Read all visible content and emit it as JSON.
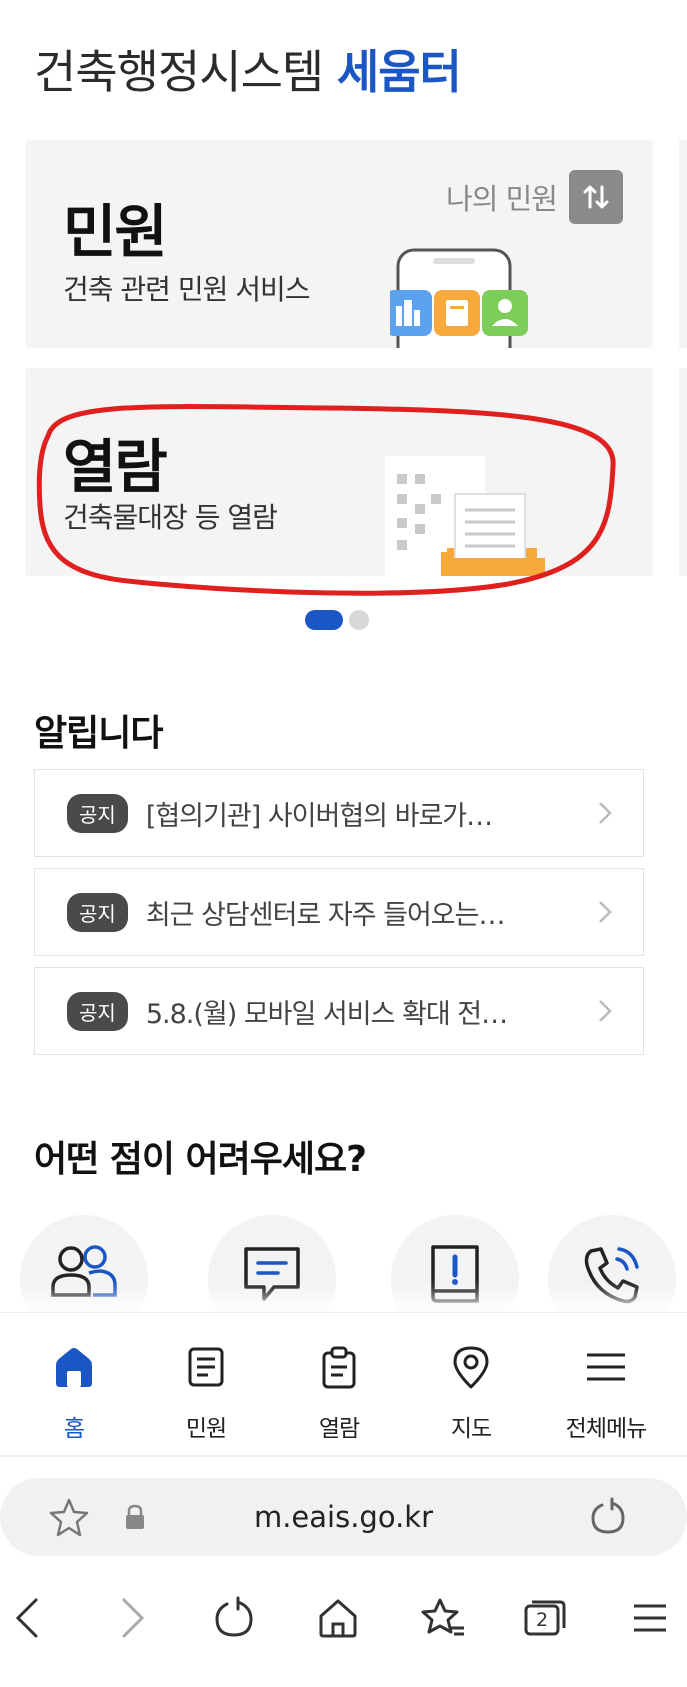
{
  "header": {
    "title_prefix": "건축행정시스템",
    "title_brand": "세움터"
  },
  "cards": {
    "minwon": {
      "title": "민원",
      "description": "건축 관련 민원 서비스",
      "my_minwon_label": "나의 민원"
    },
    "yeollam": {
      "title": "열람",
      "description": "건축물대장 등 열람"
    }
  },
  "carousel": {
    "page_count": 2,
    "active_index": 0
  },
  "notices": {
    "title": "알립니다",
    "items": [
      {
        "badge": "공지",
        "text": "[협의기관] 사이버협의 바로가…"
      },
      {
        "badge": "공지",
        "text": "최근 상담센터로 자주 들어오는…"
      },
      {
        "badge": "공지",
        "text": "5.8.(월) 모바일 서비스 확대 전…"
      }
    ]
  },
  "help": {
    "title": "어떤 점이 어려우세요?",
    "icons": [
      "people-icon",
      "chat-icon",
      "manual-icon",
      "phone-call-icon"
    ]
  },
  "bottom_nav": {
    "items": [
      {
        "label": "홈",
        "icon": "home-icon",
        "active": true
      },
      {
        "label": "민원",
        "icon": "document-icon",
        "active": false
      },
      {
        "label": "열람",
        "icon": "clipboard-icon",
        "active": false
      },
      {
        "label": "지도",
        "icon": "map-pin-icon",
        "active": false
      },
      {
        "label": "전체메뉴",
        "icon": "menu-icon",
        "active": false
      }
    ]
  },
  "browser": {
    "url": "m.eais.go.kr",
    "tab_count": "2"
  },
  "colors": {
    "brand_blue": "#1a56c4",
    "card_bg": "#f4f4f5",
    "annotation_red": "#e01f1f"
  }
}
